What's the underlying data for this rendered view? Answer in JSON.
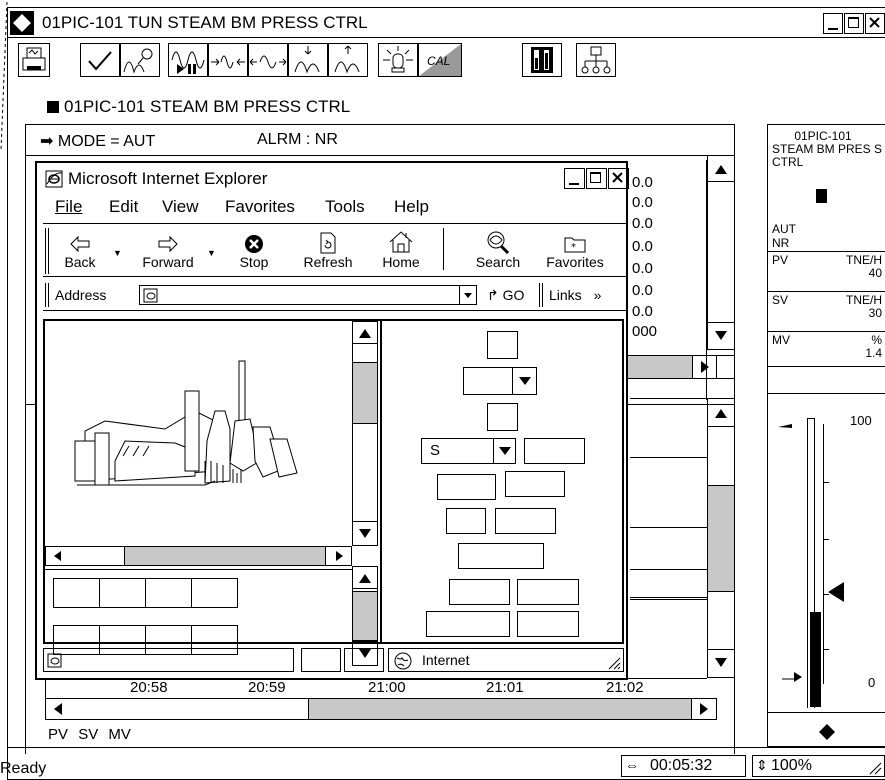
{
  "outer": {
    "title": "01PIC-101 TUN STEAM BM PRESS CTRL",
    "status": "Ready",
    "elapsed": "00:05:32",
    "zoom": "100%"
  },
  "panel": {
    "heading": "01PIC-101 STEAM BM PRESS CTRL",
    "mode_text": "MODE  = AUT",
    "alarm_text": "ALRM   : NR",
    "values": [
      "0.0",
      "0.0",
      "0.0",
      "0.0",
      "0.0",
      "0.0",
      "0.0",
      "000"
    ],
    "time_labels": [
      "20:58",
      "20:59",
      "21:00",
      "21:01",
      "21:02"
    ],
    "legend": [
      "PV",
      "SV",
      "MV"
    ]
  },
  "faceplate": {
    "tag": "01PIC-101",
    "desc": "STEAM BM PRES S CTRL",
    "mode": "AUT",
    "alarm": "NR",
    "rows": [
      {
        "label": "PV",
        "unit": "TNE/H",
        "value": "40"
      },
      {
        "label": "SV",
        "unit": "TNE/H",
        "value": "30"
      },
      {
        "label": "MV",
        "unit": "%",
        "value": "1.4"
      }
    ],
    "scale_high": "100",
    "scale_low": "0",
    "mv_level": 0.28
  },
  "ie": {
    "title": "Microsoft Internet Explorer",
    "menu": [
      "File",
      "Edit",
      "View",
      "Favorites",
      "Tools",
      "Help"
    ],
    "toolbar": {
      "back": "Back",
      "forward": "Forward",
      "stop": "Stop",
      "refresh": "Refresh",
      "home": "Home",
      "search": "Search",
      "favorites": "Favorites"
    },
    "address_label": "Address",
    "go_label": "GO",
    "links_label": "Links",
    "select_value": "S",
    "zone": "Internet"
  }
}
